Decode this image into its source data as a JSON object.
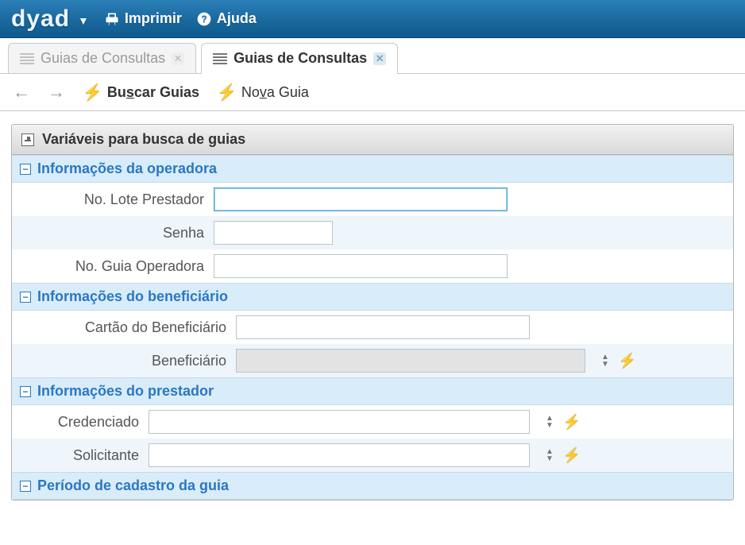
{
  "header": {
    "logo_text": "dyad",
    "print_label": "Imprimir",
    "help_label": "Ajuda"
  },
  "tabs": [
    {
      "label": "Guias de Consultas",
      "active": false
    },
    {
      "label": "Guias de Consultas",
      "active": true
    }
  ],
  "actions": {
    "search_prefix": "Bu",
    "search_underline": "s",
    "search_suffix": "car Guias",
    "new_prefix": "No",
    "new_underline": "v",
    "new_suffix": "a Guia"
  },
  "panel": {
    "title": "Variáveis para busca de guias"
  },
  "sections": {
    "operadora": {
      "title": "Informações da operadora",
      "fields": {
        "lote_prestador": {
          "label": "No. Lote Prestador",
          "value": ""
        },
        "senha": {
          "label": "Senha",
          "value": ""
        },
        "guia_operadora": {
          "label": "No. Guia Operadora",
          "value": ""
        }
      }
    },
    "beneficiario": {
      "title": "Informações do beneficiário",
      "fields": {
        "cartao": {
          "label": "Cartão do Beneficiário",
          "value": ""
        },
        "beneficiario": {
          "label": "Beneficiário",
          "value": ""
        }
      }
    },
    "prestador": {
      "title": "Informações do prestador",
      "fields": {
        "credenciado": {
          "label": "Credenciado",
          "value": ""
        },
        "solicitante": {
          "label": "Solicitante",
          "value": ""
        }
      }
    },
    "periodo": {
      "title": "Período de cadastro da guia"
    }
  }
}
